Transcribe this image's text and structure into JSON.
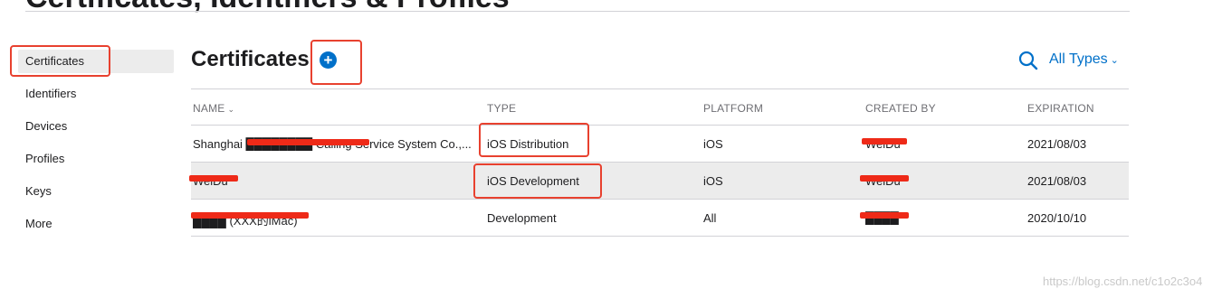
{
  "page": {
    "heading": "Certificates, Identifiers & Profiles"
  },
  "sidebar": {
    "items": [
      {
        "label": "Certificates",
        "selected": true
      },
      {
        "label": "Identifiers"
      },
      {
        "label": "Devices"
      },
      {
        "label": "Profiles"
      },
      {
        "label": "Keys"
      },
      {
        "label": "More"
      }
    ]
  },
  "main": {
    "title": "Certificates",
    "add_icon": "plus-circle-icon",
    "filter_label": "All Types",
    "search_icon": "magnifier-icon",
    "accent_color": "#0070c9",
    "columns": {
      "name": "NAME",
      "type": "TYPE",
      "platform": "PLATFORM",
      "created_by": "CREATED BY",
      "expiration": "EXPIRATION"
    },
    "rows": [
      {
        "name": "Shanghai ████████ Calling Service System Co.,...",
        "type": "iOS Distribution",
        "platform": "iOS",
        "created_by": "WeiDu",
        "expiration": "2021/08/03"
      },
      {
        "name": "WeiDu",
        "type": "iOS Development",
        "platform": "iOS",
        "created_by": "WeiDu",
        "expiration": "2021/08/03"
      },
      {
        "name": "████ (XXX的iMac)",
        "type": "Development",
        "platform": "All",
        "created_by": "████",
        "expiration": "2020/10/10"
      }
    ]
  },
  "annotation_color": "#e8412f",
  "watermark": "https://blog.csdn.net/c1o2c3o4"
}
